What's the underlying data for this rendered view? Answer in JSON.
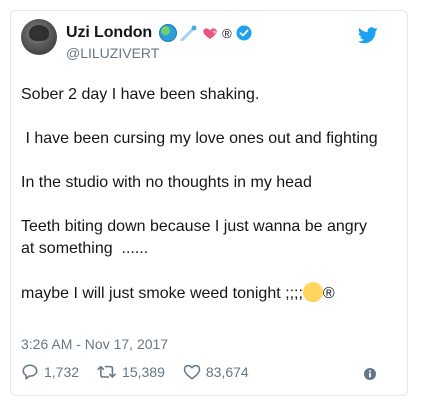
{
  "author": {
    "display_name": "Uzi London",
    "handle": "@LILUZIVERT",
    "name_suffix": "®",
    "icons": [
      "globe-emoji",
      "comet-emoji",
      "hearts-emoji",
      "verified-badge-icon"
    ]
  },
  "tweet": {
    "paragraphs": [
      "Sober 2 day I have been shaking.",
      " I have been cursing my love ones out and fighting",
      "In the studio with no thoughts in my head",
      "Teeth biting down because I just wanna be angry at something  ......"
    ],
    "last_line_text": "maybe I will just smoke weed tonight ;;;;",
    "last_line_suffix": "®",
    "timestamp": "3:26 AM - Nov 17, 2017"
  },
  "stats": {
    "replies": "1,732",
    "retweets": "15,389",
    "likes": "83,674"
  },
  "colors": {
    "brand": "#1da1f2",
    "muted": "#657786",
    "text": "#14171a"
  }
}
